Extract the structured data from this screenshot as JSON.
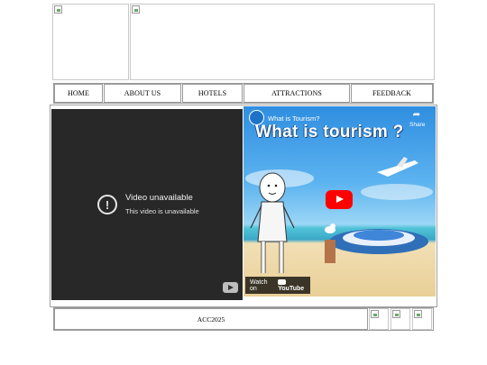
{
  "header": {
    "logo_image": "broken-image",
    "banner_image": "broken-image"
  },
  "nav": {
    "items": [
      {
        "label": "HOME"
      },
      {
        "label": "ABOUT US"
      },
      {
        "label": "HOTELS"
      },
      {
        "label": "ATTRACTIONS"
      },
      {
        "label": "FEEDBACK"
      }
    ]
  },
  "videos": {
    "left": {
      "status_title": "Video unavailable",
      "status_text": "This video is unavailable"
    },
    "right": {
      "title": "What is Tourism?",
      "overlay_text": "What is tourism ?",
      "share_label": "Share",
      "watch_on_label": "Watch on",
      "platform_label": "YouTube"
    }
  },
  "footer": {
    "copyright": "ACC2025",
    "social_icons": [
      "broken-image",
      "broken-image",
      "broken-image"
    ]
  }
}
